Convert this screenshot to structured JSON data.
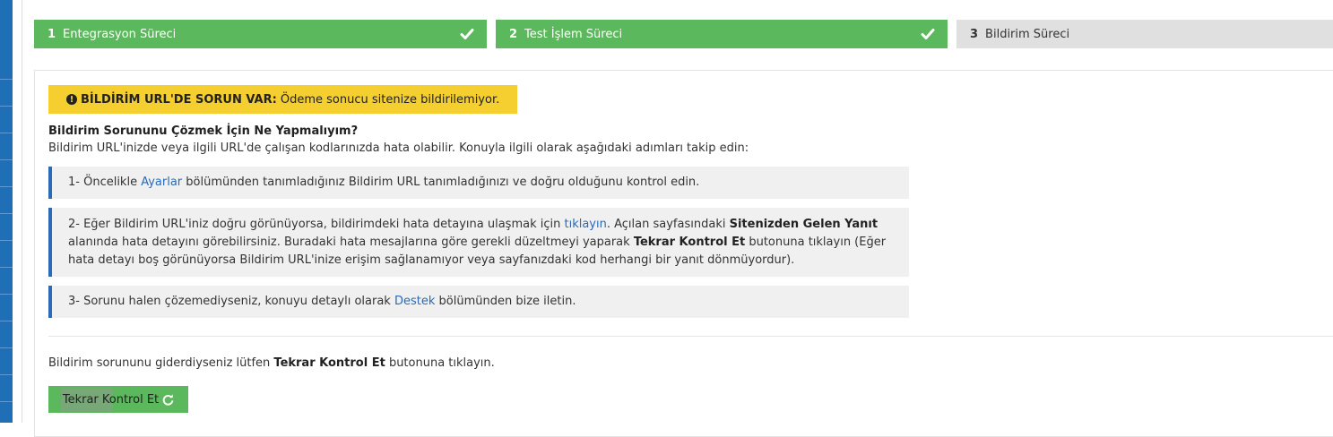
{
  "steps": [
    {
      "number": "1",
      "label": "Entegrasyon Süreci",
      "status": "done",
      "icon": "check-icon"
    },
    {
      "number": "2",
      "label": "Test İşlem Süreci",
      "status": "done",
      "icon": "check-icon"
    },
    {
      "number": "3",
      "label": "Bildirim Süreci",
      "status": "pending"
    }
  ],
  "alert": {
    "icon": "exclamation-circle-icon",
    "title": "BİLDİRİM URL'DE SORUN VAR:",
    "message": "Ödeme sonucu sitenize bildirilemiyor."
  },
  "help": {
    "title": "Bildirim Sorununu Çözmek İçin Ne Yapmalıyım?",
    "intro": "Bildirim URL'inizde veya ilgili URL'de çalışan kodlarınızda hata olabilir. Konuyla ilgili olarak aşağıdaki adımları takip edin:",
    "step1": {
      "before": "1- Öncelikle ",
      "link": "Ayarlar",
      "after": " bölümünden tanımladığınız Bildirim URL tanımladığınızı ve doğru olduğunu kontrol edin."
    },
    "step2": {
      "before": "2- Eğer Bildirim URL'iniz doğru görünüyorsa, bildirimdeki hata detayına ulaşmak için ",
      "link": "tıklayın",
      "mid1": ". Açılan sayfasındaki ",
      "bold1": "Sitenizden Gelen Yanıt",
      "mid2": " alanında hata detayını görebilirsiniz. Buradaki hata mesajlarına göre gerekli düzeltmeyi yaparak ",
      "bold2": "Tekrar Kontrol Et",
      "after": " butonuna tıklayın (Eğer hata detayı boş görünüyorsa Bildirim URL'inize erişim sağlanamıyor veya sayfanızdaki kod herhangi bir yanıt dönmüyordur)."
    },
    "step3": {
      "before": "3- Sorunu halen çözemediyseniz, konuyu detaylı olarak ",
      "link": "Destek",
      "after": " bölümünden bize iletin."
    }
  },
  "retry": {
    "text_before": "Bildirim sorununu giderdiyseniz lütfen ",
    "text_bold": "Tekrar Kontrol Et",
    "text_after": " butonuna tıklayın.",
    "button_label": "Tekrar Kontrol Et",
    "button_icon": "refresh-icon"
  },
  "colors": {
    "step_done": "#5cb85c",
    "step_pending": "#e0e0e0",
    "alert": "#f5cf2f",
    "link": "#2a6ab7",
    "accent_border": "#2a6ab7",
    "sidebar": "#1f6fb6"
  }
}
